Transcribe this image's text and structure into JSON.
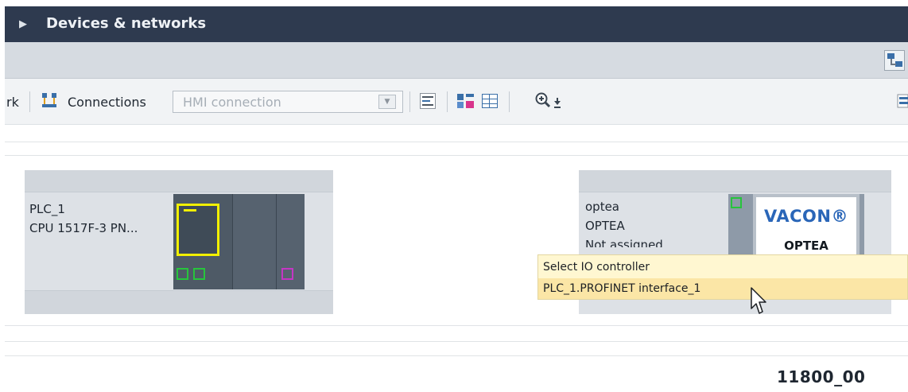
{
  "panel": {
    "title": "Devices & networks",
    "expand_icon": "triangle-right-icon"
  },
  "toolbar": {
    "network_partial": "rk",
    "connections_label": "Connections",
    "connection_type": {
      "value": "HMI connection",
      "placeholder": "HMI connection"
    },
    "icons": [
      "connections-icon",
      "address-icon",
      "highlight-icon",
      "table-icon",
      "zoom-in-icon",
      "zoom-dropdown-icon"
    ]
  },
  "devices": {
    "plc": {
      "name": "PLC_1",
      "type": "CPU 1517F-3 PN..."
    },
    "drive": {
      "name": "optea",
      "type": "OPTEA",
      "partial_label": "Not assigned",
      "brand": "VACON®",
      "model": "OPTEA"
    }
  },
  "dropdown": {
    "header": "Select IO controller",
    "options": [
      "PLC_1.PROFINET interface_1"
    ]
  },
  "figure_id": "11800_00",
  "colors": {
    "titlebar": "#2e3a4f",
    "subbar": "#d6dbe1",
    "cpu_highlight": "#f2f000",
    "port_green": "#27c43c",
    "port_purple": "#c437c4",
    "vacon_blue": "#2a66b8",
    "dropdown_bg": "#fff7d1",
    "dropdown_selected": "#fbe6a6"
  }
}
